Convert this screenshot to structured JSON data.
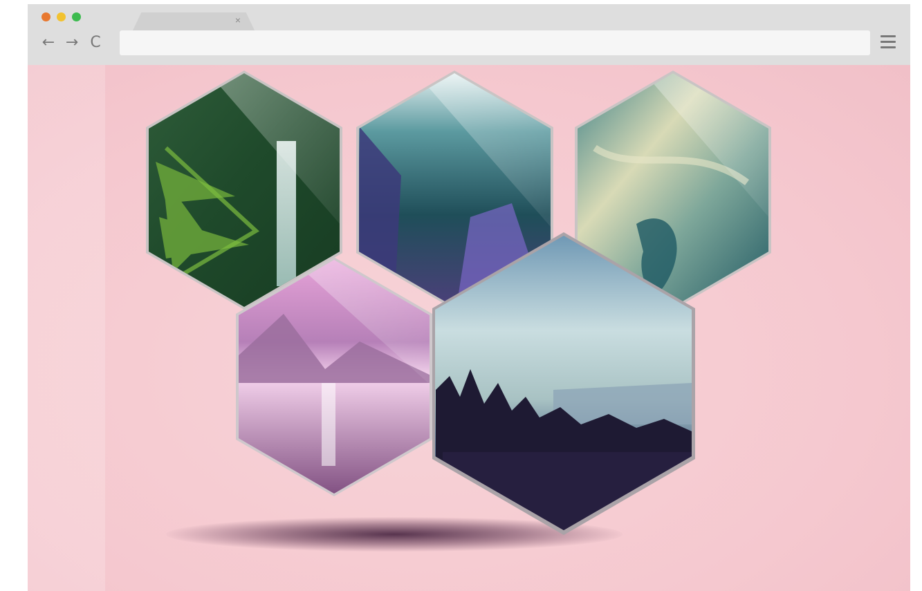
{
  "browser": {
    "traffic_lights": [
      "#e8782f",
      "#f2c230",
      "#3dbb4f"
    ],
    "tab": {
      "close_icon": "close-icon"
    },
    "nav": {
      "back_icon": "←",
      "forward_icon": "→",
      "reload_icon": "C"
    },
    "menu_icon": "hamburger-menu-icon"
  },
  "gallery": {
    "background_color": "#f5c8cf",
    "tiles": [
      {
        "subject": "fern-waterfall",
        "icon": "forest-waterfall-photo"
      },
      {
        "subject": "misty-valley",
        "icon": "valley-photo"
      },
      {
        "subject": "teal-marble",
        "icon": "marble-photo"
      },
      {
        "subject": "pink-lake",
        "icon": "lake-photo"
      },
      {
        "subject": "forest-overlook",
        "icon": "forest-photo"
      }
    ]
  }
}
